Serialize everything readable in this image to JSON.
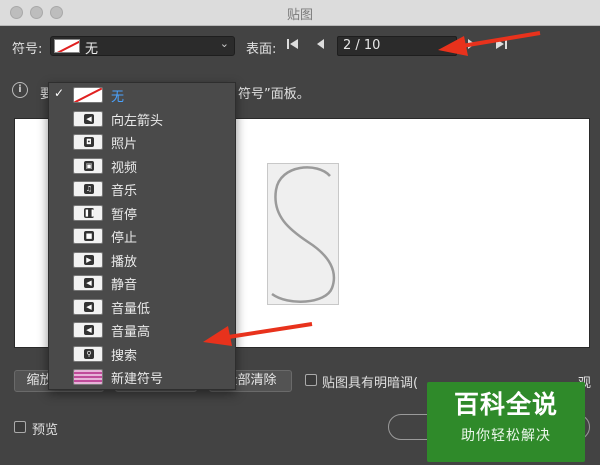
{
  "window": {
    "title": "贴图"
  },
  "toolbar": {
    "symbol_label": "符号:",
    "symbol_value": "无",
    "surface_label": "表面:",
    "page_value": "2 / 10"
  },
  "info": {
    "text_start": "要",
    "text_end": "符号”面板。"
  },
  "symbol_menu": {
    "items": [
      {
        "label": "无",
        "icon": "none-swatch-icon",
        "checked": true
      },
      {
        "label": "向左箭头",
        "icon": "left-arrow-symbol-icon"
      },
      {
        "label": "照片",
        "icon": "photo-symbol-icon"
      },
      {
        "label": "视频",
        "icon": "video-symbol-icon"
      },
      {
        "label": "音乐",
        "icon": "music-symbol-icon"
      },
      {
        "label": "暂停",
        "icon": "pause-symbol-icon"
      },
      {
        "label": "停止",
        "icon": "stop-symbol-icon"
      },
      {
        "label": "播放",
        "icon": "play-symbol-icon"
      },
      {
        "label": "静音",
        "icon": "mute-symbol-icon"
      },
      {
        "label": "音量低",
        "icon": "volume-low-symbol-icon"
      },
      {
        "label": "音量高",
        "icon": "volume-high-symbol-icon"
      },
      {
        "label": "搜索",
        "icon": "search-symbol-icon"
      },
      {
        "label": "新建符号",
        "icon": "new-symbol-icon"
      }
    ]
  },
  "buttons": {
    "zoom_fit": "缩放以适合",
    "clear": "清除",
    "clear_all": "全部清除"
  },
  "options": {
    "shade_artwork": "贴图具有明暗调(",
    "shade_tail": "观",
    "preview": "预览"
  },
  "watermark": {
    "line1": "百科全说",
    "line2": "助你轻松解决"
  },
  "colors": {
    "accent_arrow": "#e8321c",
    "selected_text": "#4aa3ff",
    "watermark_bg": "#2f8a2a"
  }
}
